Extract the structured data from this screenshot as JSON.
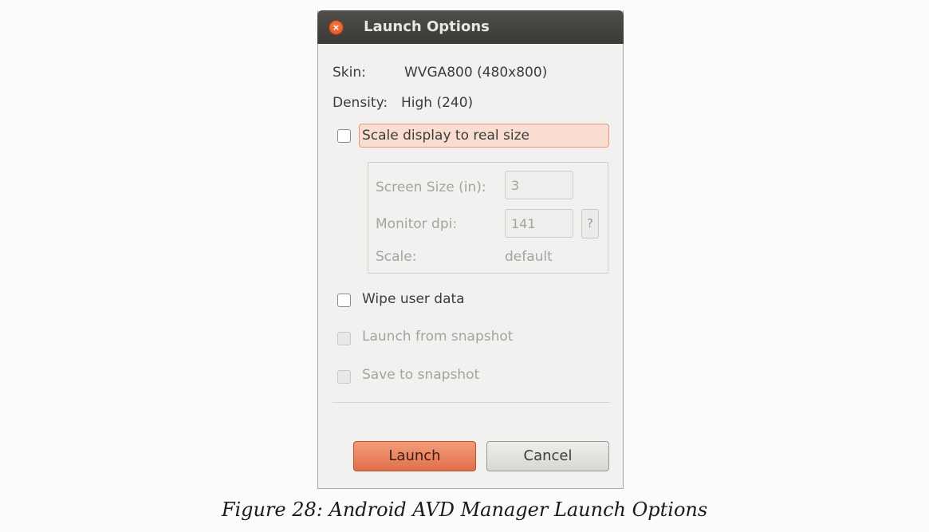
{
  "dialog": {
    "title": "Launch Options",
    "close_icon": "close-icon",
    "skin_label": "Skin:",
    "skin_value": "WVGA800 (480x800)",
    "density_label": "Density:",
    "density_value": "High (240)",
    "scale_display_label": "Scale display to real size",
    "scale_display_checked": false,
    "scale_group": {
      "screen_size_label": "Screen Size (in):",
      "screen_size_value": "3",
      "monitor_dpi_label": "Monitor dpi:",
      "monitor_dpi_value": "141",
      "help_label": "?",
      "scale_label": "Scale:",
      "scale_value": "default"
    },
    "wipe_user_data_label": "Wipe user data",
    "wipe_user_data_checked": false,
    "launch_from_snapshot_label": "Launch from snapshot",
    "save_to_snapshot_label": "Save to snapshot",
    "launch_button": "Launch",
    "cancel_button": "Cancel"
  },
  "caption": "Figure 28: Android AVD Manager Launch Options",
  "colors": {
    "titlebar": "#3b3a36",
    "accent_orange": "#e2704a",
    "dialog_bg": "#f2f1f0",
    "focus_highlight": "#f9ddd1"
  }
}
